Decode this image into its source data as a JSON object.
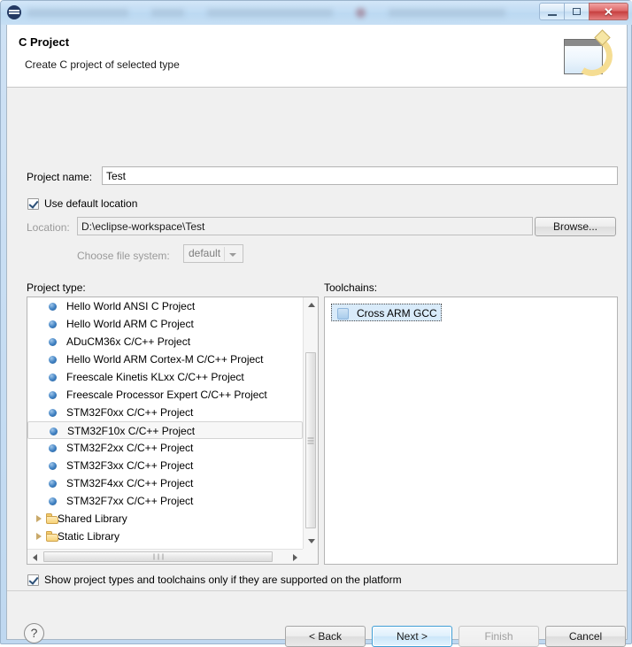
{
  "window": {
    "title_redacted": true,
    "controls": {
      "minimize": "Minimize",
      "maximize": "Maximize",
      "close": "Close"
    }
  },
  "wizard": {
    "title": "C Project",
    "subtitle": "Create C project of selected type",
    "banner_icon": "wizard-page-icon"
  },
  "form": {
    "project_name_label": "Project name:",
    "project_name_value": "Test",
    "project_name_placeholder": "",
    "use_default_location_label": "Use default location",
    "use_default_location_checked": true,
    "location_label": "Location:",
    "location_value": "D:\\eclipse-workspace\\Test",
    "browse_label": "Browse...",
    "file_system_label": "Choose file system:",
    "file_system_value": "default",
    "file_system_options": [
      "default"
    ]
  },
  "project_type": {
    "label": "Project type:",
    "items": [
      {
        "label": "Hello World ANSI C Project",
        "kind": "leaf",
        "selected": false
      },
      {
        "label": "Hello World ARM C Project",
        "kind": "leaf",
        "selected": false
      },
      {
        "label": "ADuCM36x C/C++ Project",
        "kind": "leaf",
        "selected": false
      },
      {
        "label": "Hello World ARM Cortex-M C/C++ Project",
        "kind": "leaf",
        "selected": false
      },
      {
        "label": "Freescale Kinetis KLxx C/C++ Project",
        "kind": "leaf",
        "selected": false
      },
      {
        "label": "Freescale Processor Expert C/C++ Project",
        "kind": "leaf",
        "selected": false
      },
      {
        "label": "STM32F0xx C/C++ Project",
        "kind": "leaf",
        "selected": false
      },
      {
        "label": "STM32F10x C/C++ Project",
        "kind": "leaf",
        "selected": true
      },
      {
        "label": "STM32F2xx C/C++ Project",
        "kind": "leaf",
        "selected": false
      },
      {
        "label": "STM32F3xx C/C++ Project",
        "kind": "leaf",
        "selected": false
      },
      {
        "label": "STM32F4xx C/C++ Project",
        "kind": "leaf",
        "selected": false
      },
      {
        "label": "STM32F7xx C/C++ Project",
        "kind": "leaf",
        "selected": false
      },
      {
        "label": "Shared Library",
        "kind": "folder",
        "selected": false
      },
      {
        "label": "Static Library",
        "kind": "folder",
        "selected": false
      }
    ]
  },
  "toolchains": {
    "label": "Toolchains:",
    "items": [
      {
        "label": "Cross ARM GCC",
        "selected": true
      }
    ]
  },
  "filter": {
    "label": "Show project types and toolchains only if they are supported on the platform",
    "checked": true
  },
  "footer": {
    "help_glyph": "?",
    "back_label": "< Back",
    "next_label": "Next >",
    "finish_label": "Finish",
    "cancel_label": "Cancel",
    "finish_disabled": true,
    "next_is_default": true
  },
  "colors": {
    "accent": "#3f9ed6",
    "titlebar": "#bcd9f2",
    "dialog_bg": "#f0f0f0",
    "close_button": "#c74040",
    "bullet": "#3d7fc1",
    "folder": "#f5cd6c"
  }
}
